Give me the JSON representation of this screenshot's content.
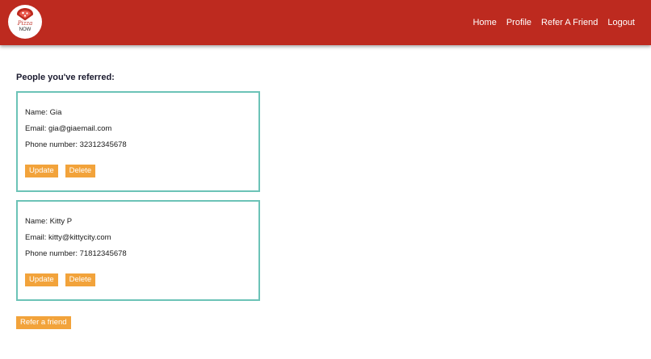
{
  "brand": {
    "logo_top": "Pizza",
    "logo_bottom": "NOW",
    "color": "#bd2a1f"
  },
  "nav": {
    "items": [
      {
        "label": "Home",
        "name": "nav-home"
      },
      {
        "label": "Profile",
        "name": "nav-profile"
      },
      {
        "label": "Refer A Friend",
        "name": "nav-refer-a-friend"
      },
      {
        "label": "Logout",
        "name": "nav-logout"
      }
    ]
  },
  "main": {
    "title": "People you've referred:",
    "referrals": [
      {
        "name_line": "Name: Gia",
        "email_line": "Email: gia@giaemail.com",
        "phone_line": "Phone number: 32312345678",
        "update_label": "Update",
        "delete_label": "Delete"
      },
      {
        "name_line": "Name: Kitty P",
        "email_line": "Email: kitty@kittycity.com",
        "phone_line": "Phone number: 71812345678",
        "update_label": "Update",
        "delete_label": "Delete"
      }
    ],
    "refer_label": "Refer a friend"
  },
  "colors": {
    "navbar": "#bd2a1f",
    "button": "#f2a33b",
    "card_border": "#6cc3b7"
  },
  "icons": {
    "logo": "pizza-slice-location-icon"
  }
}
